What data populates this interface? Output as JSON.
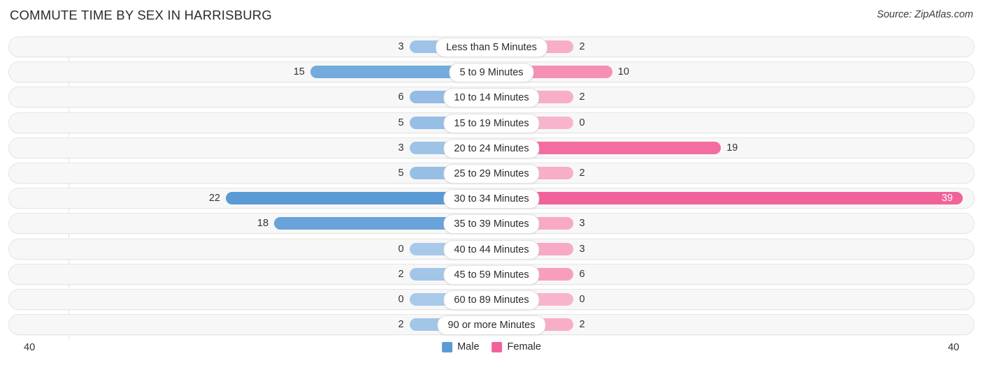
{
  "header": {
    "title": "COMMUTE TIME BY SEX IN HARRISBURG",
    "source": "Source: ZipAtlas.com"
  },
  "axis": {
    "left_label": "40",
    "right_label": "40",
    "max": 40
  },
  "legend": {
    "items": [
      {
        "label": "Male",
        "color": "#5b9bd5"
      },
      {
        "label": "Female",
        "color": "#f2629a"
      }
    ]
  },
  "colors": {
    "male": "#5b9bd5",
    "female": "#f2629a",
    "male_light": "#a9c9ea",
    "female_light": "#f9b4cd",
    "track": "#f7f7f7",
    "track_border": "#e6e6e6",
    "gridline": "#e3e3e3"
  },
  "chart_data": {
    "type": "bar",
    "title": "COMMUTE TIME BY SEX IN HARRISBURG",
    "subtitle": "",
    "xlabel": "",
    "ylabel": "",
    "orientation": "horizontal-diverging",
    "legend_position": "bottom-center",
    "grid": false,
    "xlim": [
      40,
      40
    ],
    "categories": [
      "Less than 5 Minutes",
      "5 to 9 Minutes",
      "10 to 14 Minutes",
      "15 to 19 Minutes",
      "20 to 24 Minutes",
      "25 to 29 Minutes",
      "30 to 34 Minutes",
      "35 to 39 Minutes",
      "40 to 44 Minutes",
      "45 to 59 Minutes",
      "60 to 89 Minutes",
      "90 or more Minutes"
    ],
    "series": [
      {
        "name": "Male",
        "color": "#5b9bd5",
        "values": [
          3,
          15,
          6,
          5,
          3,
          5,
          22,
          18,
          0,
          2,
          0,
          2
        ]
      },
      {
        "name": "Female",
        "color": "#f2629a",
        "values": [
          2,
          10,
          2,
          0,
          19,
          2,
          39,
          3,
          3,
          6,
          0,
          2
        ]
      }
    ]
  }
}
